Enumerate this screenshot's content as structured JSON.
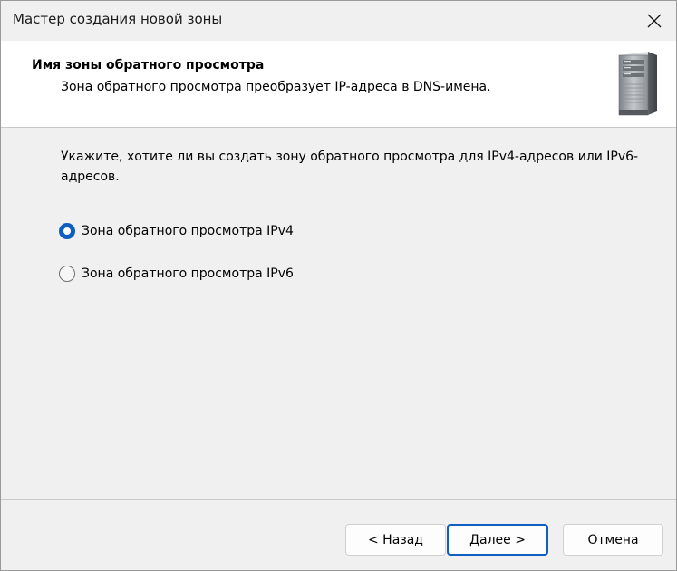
{
  "window": {
    "title": "Мастер создания новой зоны",
    "close_icon": "close-icon"
  },
  "header": {
    "title": "Имя зоны обратного просмотра",
    "subtitle": "Зона обратного просмотра преобразует IP-адреса в DNS-имена.",
    "icon": "server-icon"
  },
  "content": {
    "instruction": "Укажите, хотите ли вы создать зону обратного просмотра для IPv4-адресов или IPv6-адресов.",
    "options": [
      {
        "label": "Зона обратного просмотра IPv4",
        "checked": true
      },
      {
        "label": "Зона обратного просмотра IPv6",
        "checked": false
      }
    ]
  },
  "buttons": {
    "back_label": "< Назад",
    "next_label": "Далее >",
    "cancel_label": "Отмена"
  },
  "colors": {
    "accent": "#0f5ec2",
    "background": "#f0f0f0",
    "header_background": "#ffffff"
  }
}
